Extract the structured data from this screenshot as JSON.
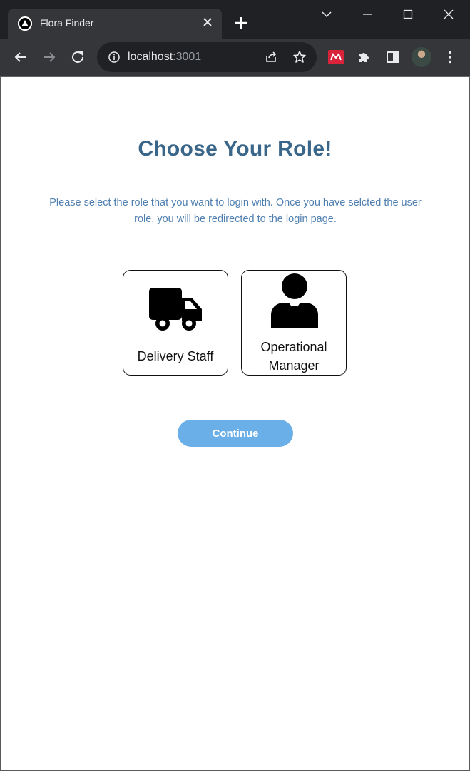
{
  "browser": {
    "tab_title": "Flora Finder",
    "url_host": "localhost",
    "url_port": ":3001"
  },
  "page": {
    "heading": "Choose Your Role!",
    "subtitle": "Please select the role that you want to login with. Once you have selcted the user role, you will be redirected to the login page.",
    "roles": [
      {
        "label": "Delivery Staff",
        "icon": "delivery-truck-icon"
      },
      {
        "label": "Operational Manager",
        "icon": "manager-icon"
      }
    ],
    "continue_label": "Continue"
  },
  "colors": {
    "heading": "#3a6689",
    "subtitle": "#4f7fb0",
    "button": "#6aafe8"
  }
}
